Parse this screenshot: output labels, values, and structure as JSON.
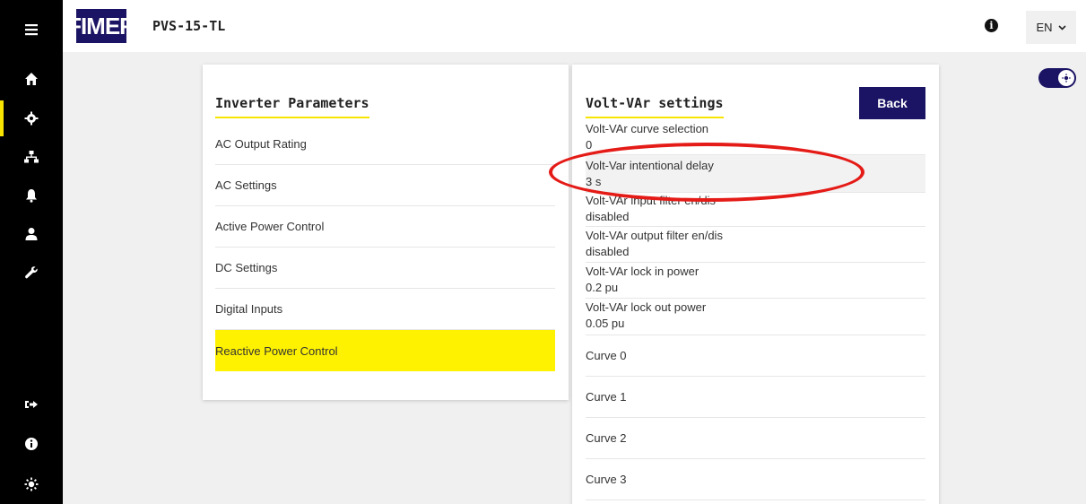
{
  "header": {
    "logo_text": "FIMER",
    "device_name": "PVS-15-TL",
    "info_icon": "info-icon",
    "language": "EN"
  },
  "sidebar": {
    "top_items": [
      {
        "name": "menu",
        "icon": "hamburger-icon"
      },
      {
        "name": "home",
        "icon": "home-icon"
      },
      {
        "name": "settings",
        "icon": "gear-icon",
        "active": true
      },
      {
        "name": "network",
        "icon": "network-icon"
      },
      {
        "name": "alarms",
        "icon": "bell-icon"
      },
      {
        "name": "user",
        "icon": "user-icon"
      },
      {
        "name": "tools",
        "icon": "wrench-icon"
      }
    ],
    "bottom_items": [
      {
        "name": "logout",
        "icon": "logout-icon"
      },
      {
        "name": "info",
        "icon": "info-icon"
      },
      {
        "name": "brightness",
        "icon": "sun-icon"
      }
    ]
  },
  "left_card": {
    "title": "Inverter Parameters",
    "items": [
      {
        "label": "AC Output Rating"
      },
      {
        "label": "AC Settings"
      },
      {
        "label": "Active Power Control"
      },
      {
        "label": "DC Settings"
      },
      {
        "label": "Digital Inputs"
      },
      {
        "label": "Reactive Power Control",
        "selected": true
      }
    ]
  },
  "right_card": {
    "title": "Volt-VAr settings",
    "back_label": "Back",
    "params": [
      {
        "label": "Volt-VAr curve selection",
        "value": "0"
      },
      {
        "label": "Volt-Var intentional delay",
        "value": "3 s",
        "highlighted": true
      },
      {
        "label": "Volt-VAr input filter en/dis",
        "value": "disabled"
      },
      {
        "label": "Volt-VAr output filter en/dis",
        "value": "disabled"
      },
      {
        "label": "Volt-VAr lock in power",
        "value": "0.2 pu"
      },
      {
        "label": "Volt-VAr lock out power",
        "value": "0.05 pu"
      }
    ],
    "curves": [
      {
        "label": "Curve 0"
      },
      {
        "label": "Curve 1"
      },
      {
        "label": "Curve 2"
      },
      {
        "label": "Curve 3"
      }
    ]
  },
  "toggle": {
    "state": "on",
    "icon": "sun-icon"
  },
  "colors": {
    "brand": "#1b1464",
    "accent": "#fff200",
    "annotation": "#e41b17"
  }
}
